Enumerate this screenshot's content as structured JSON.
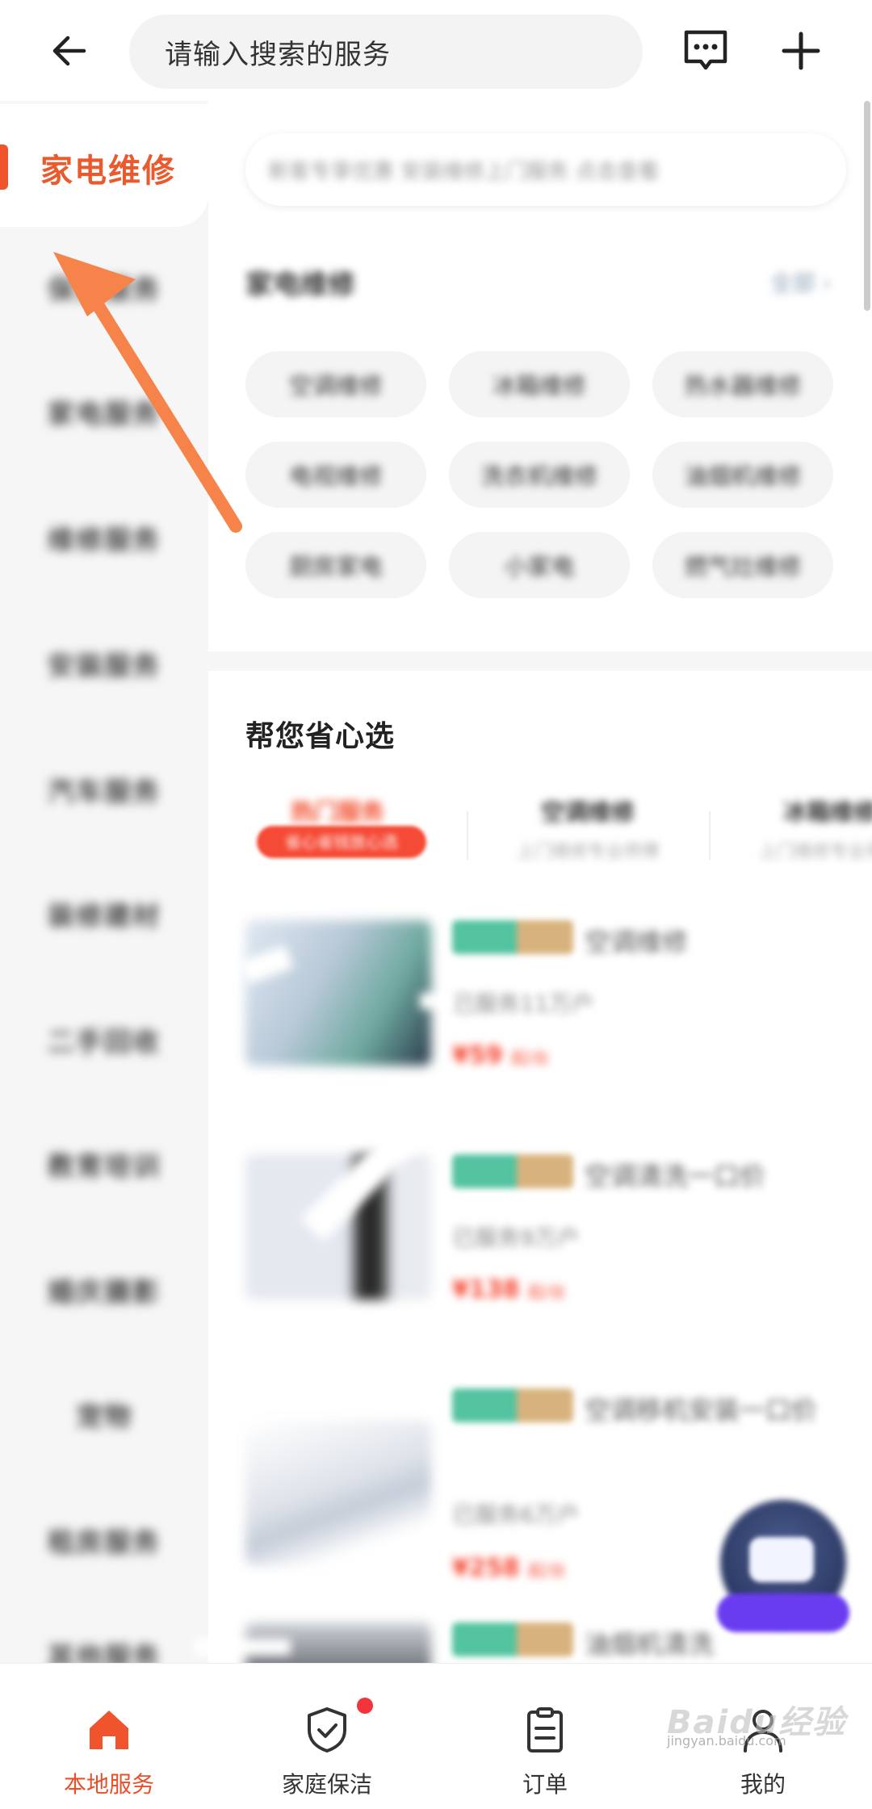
{
  "header": {
    "search_placeholder": "请输入搜索的服务"
  },
  "sidebar": {
    "active": "家电维修",
    "items": [
      "保洁服务",
      "家电服务",
      "维修服务",
      "安装服务",
      "汽车服务",
      "装修建材",
      "二手回收",
      "教育培训",
      "婚庆摄影",
      "宠物",
      "租房服务",
      "其他服务"
    ]
  },
  "notice": "新客专享优惠 安装维修上门服务 点击查看",
  "appliance_section": {
    "title": "家电维修",
    "all_label": "全部 ›",
    "chips": [
      "空调维修",
      "冰箱维修",
      "热水器维修",
      "电视维修",
      "洗衣机维修",
      "油烟机维修",
      "厨房家电",
      "小家电",
      "燃气灶维修"
    ]
  },
  "pick_section": {
    "title": "帮您省心选",
    "tabs": [
      {
        "name": "热门服务",
        "sub": "省心省钱放心选"
      },
      {
        "name": "空调维修",
        "sub": "上门维修专业师傅"
      },
      {
        "name": "冰箱维修",
        "sub": "上门维修专业师傅"
      }
    ]
  },
  "products": [
    {
      "tag1": "官方",
      "tag2": "保障",
      "name": "空调维修",
      "desc": "已服务11万户",
      "price": "¥59",
      "unit": "起/台"
    },
    {
      "tag1": "官方",
      "tag2": "保障",
      "name": "空调清洗一口价",
      "desc": "已服务9万户",
      "price": "¥138",
      "unit": "起/台"
    },
    {
      "tag1": "官方",
      "tag2": "保障",
      "name": "空调移机安装一口价",
      "desc": "已服务6万户",
      "price": "¥258",
      "unit": "起/台"
    },
    {
      "tag1": "官方",
      "tag2": "保障",
      "name": "油烟机清洗",
      "desc": "",
      "price": "",
      "unit": ""
    }
  ],
  "bottom_nav": [
    {
      "label": "本地服务",
      "active": true
    },
    {
      "label": "家庭保洁",
      "active": false
    },
    {
      "label": "订单",
      "active": false
    },
    {
      "label": "我的",
      "active": false
    }
  ],
  "watermark": {
    "main": "Baidu经验",
    "sub": "jingyan.baidu.com"
  },
  "colors": {
    "accent": "#ea5a2c",
    "price": "#f5452f",
    "arrow": "#f5834a",
    "tag_green": "#53c3a0",
    "tag_gold": "#d8b27c"
  },
  "icons": {
    "back": "arrow-left-icon",
    "message": "message-bubble-icon",
    "add": "plus-icon"
  }
}
